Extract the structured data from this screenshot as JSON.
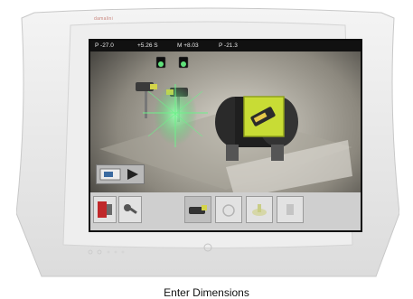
{
  "brand": {
    "label": "damalini"
  },
  "readouts": {
    "p1": "P -27.0",
    "s": "+5.26 S",
    "m": "M +8.03",
    "p2": "P -21.3"
  },
  "caption": "Enter Dimensions",
  "icons": {
    "green_indicator": "green-led-icon",
    "camera": "camera-icon",
    "play": "play-icon",
    "stop": "stop-icon",
    "tools": "tools-icon",
    "sensor": "sensor-icon",
    "machine": "machine-icon",
    "measure": "measure-icon",
    "target": "target-icon"
  },
  "colors": {
    "laser_green": "#5fe07a",
    "highlight_yellow": "#cfe03a",
    "stop_red": "#c0282a",
    "shell": "#e8e8e8",
    "screen_bg": "#1d1d1d"
  }
}
